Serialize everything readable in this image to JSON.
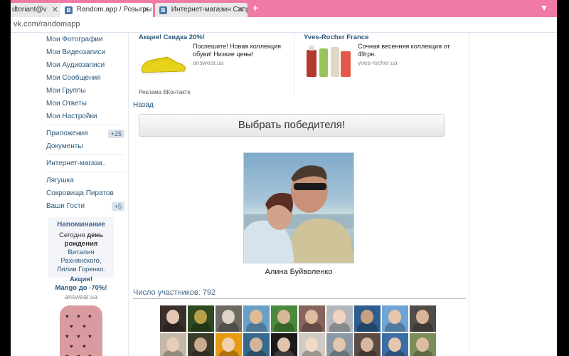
{
  "browser": {
    "tabs": [
      {
        "label": "dtoriant@v",
        "favicon": "",
        "active": false
      },
      {
        "label": "Random.app / Розыгры",
        "favicon": "В",
        "active": true
      },
      {
        "label": "Интернет-магазин Сапр",
        "favicon": "В",
        "active": false
      }
    ],
    "new_tab_label": "+",
    "close_label": "✕",
    "url": "vk.com/randomapp",
    "accent": "#f07aa6"
  },
  "sidebar": {
    "items": [
      {
        "label": "Мои Фотографии"
      },
      {
        "label": "Мои Видеозаписи"
      },
      {
        "label": "Мои Аудиозаписи"
      },
      {
        "label": "Мои Сообщения"
      },
      {
        "label": "Мои Группы"
      },
      {
        "label": "Мои Ответы"
      },
      {
        "label": "Мои Настройки"
      }
    ],
    "items2": [
      {
        "label": "Приложения",
        "badge": "+25"
      },
      {
        "label": "Документы"
      }
    ],
    "items3": [
      {
        "label": "Интернет-магази.."
      }
    ],
    "items4": [
      {
        "label": "Лягушка"
      },
      {
        "label": "Сокровища Пиратов"
      },
      {
        "label": "Ваши Гости",
        "badge": "+5"
      }
    ]
  },
  "reminder": {
    "title": "Напоминание",
    "line1": "Сегодня",
    "line1_bold": "день",
    "line2_bold": "рождения",
    "line2": "Виталия",
    "line3": "Рахнянского,",
    "line4": "Лилии Горенко."
  },
  "promo": {
    "title": "Акция!",
    "subtitle": "Mango до -70%!",
    "source": "answear.ua"
  },
  "ads": [
    {
      "title": "Акция! Скидка 20%!",
      "text": "Поспешите! Новая коллекция обуви! Низкие цены!",
      "source": "answear.ua"
    },
    {
      "title": "Yves-Rocher France",
      "text": "Сочная весенняя коллекция от 49грн.",
      "source": "yves-rocher.ua"
    }
  ],
  "ad_label": "Реклама ВКонтакте",
  "back_link": "Назад",
  "pick_button": "Выбрать победителя!",
  "winner_name": "Алина Буйволенко",
  "participants_label": "Число участников: 792",
  "grid_colors": [
    [
      "#3a2f2a",
      "#e3c7b4"
    ],
    [
      "#2d4a20",
      "#b9a04a"
    ],
    [
      "#6d6a64",
      "#ddd3c8"
    ],
    [
      "#6aa0c8",
      "#e2bb95"
    ],
    [
      "#4b8a3c",
      "#d7b79a"
    ],
    [
      "#87645c",
      "#dfbba0"
    ],
    [
      "#b4b8bc",
      "#f0d4c2"
    ],
    [
      "#2e5d8e",
      "#c9a17f"
    ],
    [
      "#6ea4d6",
      "#e7c7a8"
    ],
    [
      "#504c48",
      "#d9b595"
    ],
    [
      "#c4b8aa",
      "#e7cdb6"
    ],
    [
      "#3b3d2b",
      "#c9ac90"
    ],
    [
      "#e79b12",
      "#f0d2b0"
    ],
    [
      "#356a8e",
      "#d6b49a"
    ],
    [
      "#1b1a18",
      "#e2c4ab"
    ],
    [
      "#cfcac2",
      "#efdac7"
    ],
    [
      "#8b98a5",
      "#e3c6ab"
    ],
    [
      "#5a4b43",
      "#d8b8a0"
    ],
    [
      "#3b6ea5",
      "#e5c7ad"
    ],
    [
      "#7b8e5a",
      "#dcbca2"
    ]
  ]
}
